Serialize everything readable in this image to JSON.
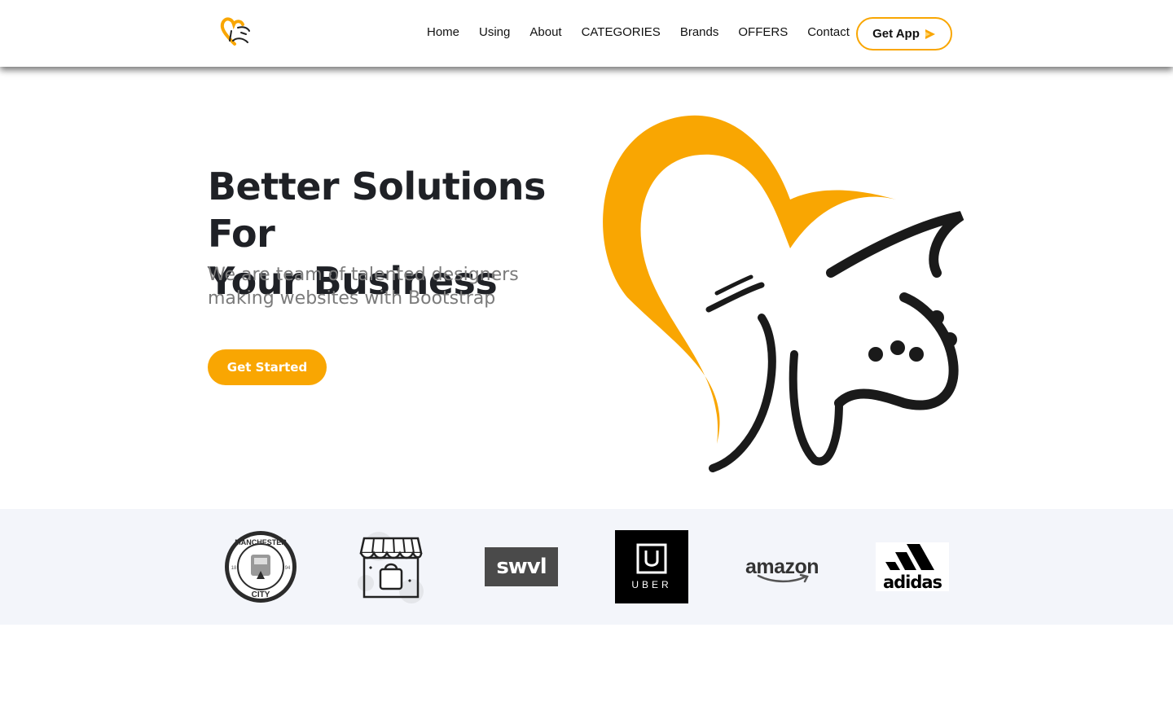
{
  "colors": {
    "accent": "#f9a602",
    "dark": "#1f2126",
    "muted": "#7b7b7b",
    "brand_strip": "#f3f5fa"
  },
  "nav": {
    "items": [
      {
        "label": "Home"
      },
      {
        "label": "Using"
      },
      {
        "label": "About"
      },
      {
        "label": "CATEGORIES"
      },
      {
        "label": "Brands"
      },
      {
        "label": "OFFERS"
      },
      {
        "label": "Contact"
      }
    ],
    "get_app_label": "Get App",
    "get_app_icon": "play-icon"
  },
  "hero": {
    "title_line1": "Better Solutions For",
    "title_line2": "Your Business",
    "subtitle": "We are team of talented designers making websites with Bootstrap",
    "cta_label": "Get Started",
    "art": "heart-calligraphy-logo"
  },
  "brands": {
    "mancity": {
      "top": "MANCHESTER",
      "bottom": "CITY",
      "left_num": "18",
      "right_num": "94"
    },
    "store": {
      "icon": "storefront-icon"
    },
    "swvl": {
      "text": "swvl"
    },
    "uber": {
      "text": "UBER"
    },
    "amazon": {
      "text": "amazon"
    },
    "adidas": {
      "text": "adidas"
    }
  }
}
